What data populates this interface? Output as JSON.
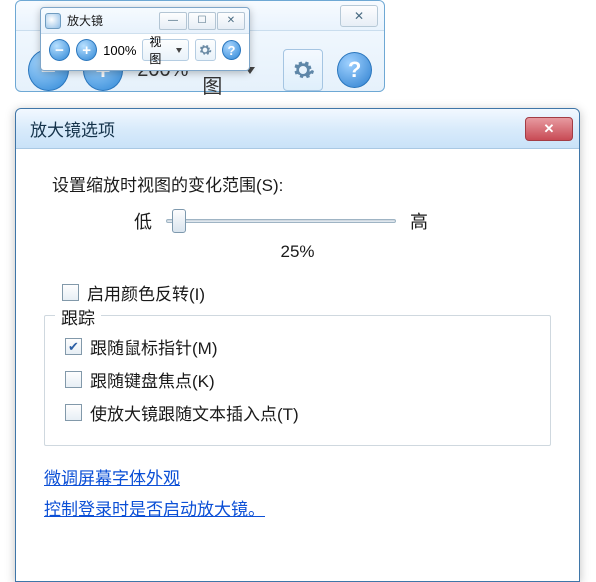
{
  "bg_toolbar": {
    "close_label": "✕",
    "zoom_level": "200%",
    "view_label": "视图"
  },
  "fg_window": {
    "title": "放大镜",
    "min_label": "—",
    "max_label": "☐",
    "close_label": "✕",
    "zoom_level": "100%",
    "view_label": "视图"
  },
  "dialog": {
    "title": "放大镜选项",
    "close_label": "✕",
    "section_heading": "设置缩放时视图的变化范围(S):",
    "slider_low_label": "低",
    "slider_high_label": "高",
    "slider_value_label": "25%",
    "color_inversion_label": "启用颜色反转(I)",
    "tracking_legend": "跟踪",
    "follow_mouse_label": "跟随鼠标指针(M)",
    "follow_keyboard_label": "跟随键盘焦点(K)",
    "follow_text_insert_label": "使放大镜跟随文本插入点(T)",
    "link_font_tuning": "微调屏幕字体外观",
    "link_startup": "控制登录时是否启动放大镜。"
  }
}
